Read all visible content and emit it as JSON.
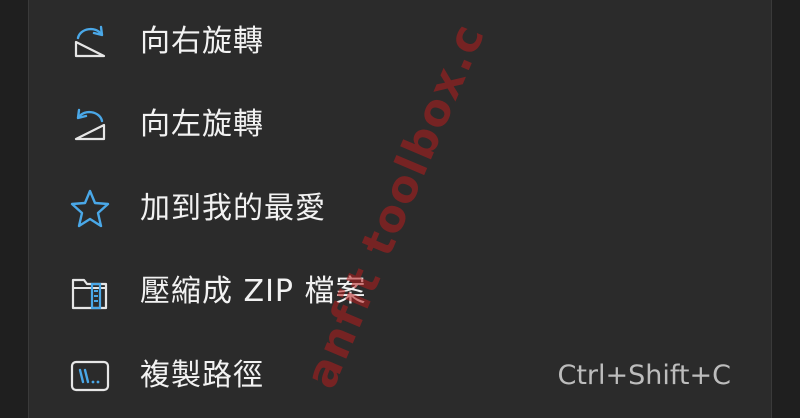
{
  "menu": {
    "items": [
      {
        "icon": "rotate-right-icon",
        "label": "向右旋轉",
        "shortcut": ""
      },
      {
        "icon": "rotate-left-icon",
        "label": "向左旋轉",
        "shortcut": ""
      },
      {
        "icon": "star-icon",
        "label": "加到我的最愛",
        "shortcut": ""
      },
      {
        "icon": "zip-folder-icon",
        "label": "壓縮成 ZIP 檔案",
        "shortcut": ""
      },
      {
        "icon": "copy-path-icon",
        "label": "複製路徑",
        "shortcut": "Ctrl+Shift+C"
      }
    ]
  },
  "watermark": {
    "text": "anfit toolbox.c"
  },
  "colors": {
    "menu_background": "#2b2b2b",
    "icon_accent": "#4aa8e8",
    "text": "#f2f2f2",
    "shortcut_text": "#bdbdbd",
    "watermark": "#b41e1e"
  }
}
